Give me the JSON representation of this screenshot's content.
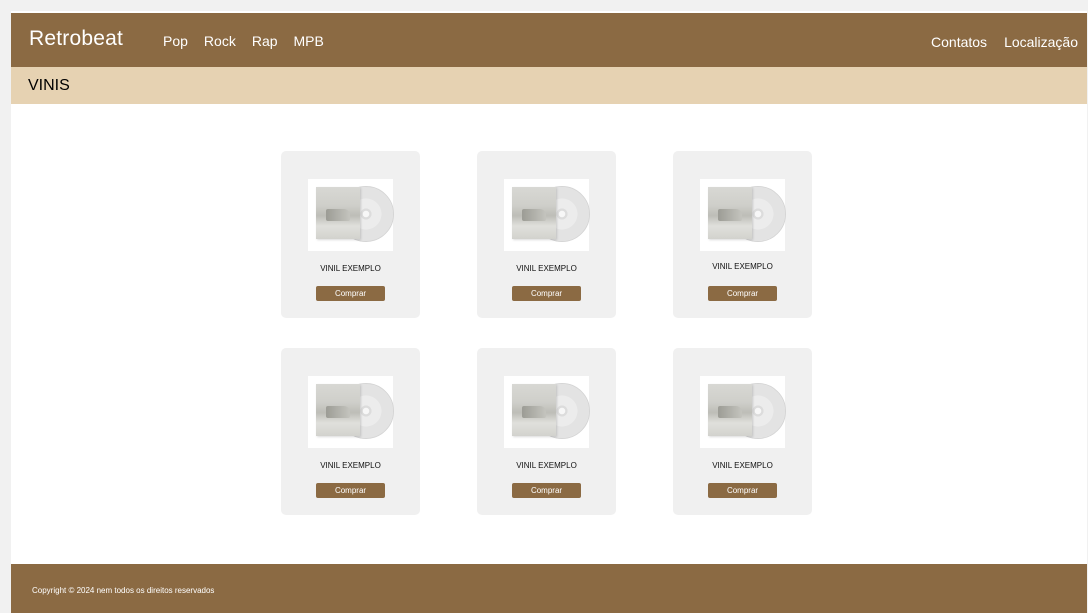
{
  "header": {
    "brand": "Retrobeat",
    "nav_left": [
      "Pop",
      "Rock",
      "Rap",
      "MPB"
    ],
    "nav_right": [
      "Contatos",
      "Localização"
    ]
  },
  "section": {
    "title": "VINIS"
  },
  "products": [
    {
      "title": "VINIL EXEMPLO",
      "button": "Comprar",
      "image": "vinyl-record-image"
    },
    {
      "title": "VINIL EXEMPLO",
      "button": "Comprar",
      "image": "vinyl-record-image"
    },
    {
      "title": "VINIL EXEMPLO",
      "button": "Comprar",
      "image": "vinyl-record-image"
    },
    {
      "title": "VINIL EXEMPLO",
      "button": "Comprar",
      "image": "vinyl-record-image"
    },
    {
      "title": "VINIL EXEMPLO",
      "button": "Comprar",
      "image": "vinyl-record-image"
    },
    {
      "title": "VINIL EXEMPLO",
      "button": "Comprar",
      "image": "vinyl-record-image"
    }
  ],
  "footer": {
    "copyright": "Copyright © 2024 nem todos os direitos reservados"
  },
  "colors": {
    "primary": "#8b6a43",
    "section_bg": "#e6d2b2",
    "card_bg": "#f0f0f0"
  }
}
